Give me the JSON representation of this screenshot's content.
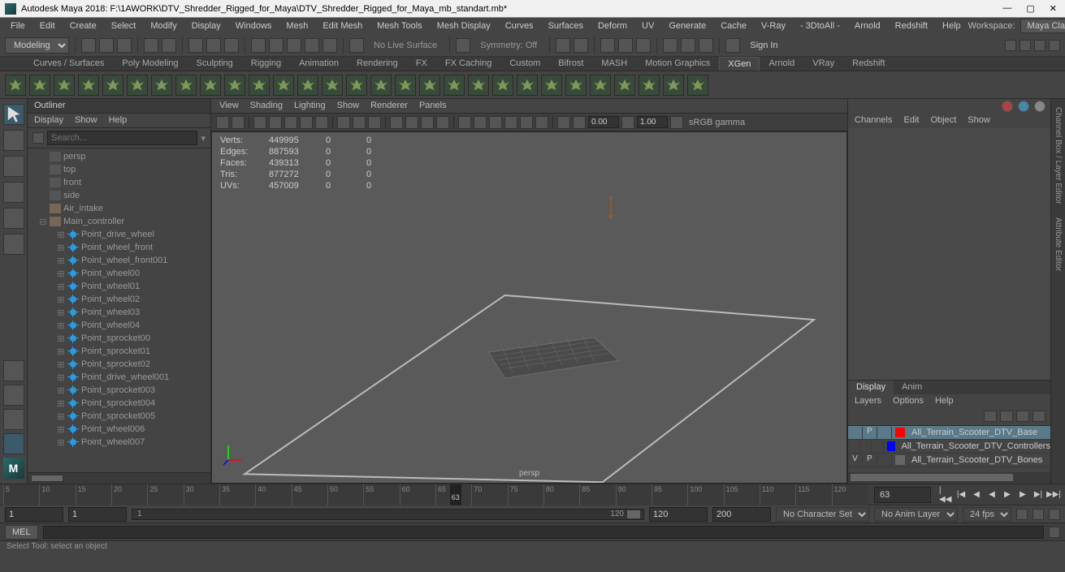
{
  "title": "Autodesk Maya 2018: F:\\1AWORK\\DTV_Shredder_Rigged_for_Maya\\DTV_Shredder_Rigged_for_Maya_mb_standart.mb*",
  "menubar": [
    "File",
    "Edit",
    "Create",
    "Select",
    "Modify",
    "Display",
    "Windows",
    "Mesh",
    "Edit Mesh",
    "Mesh Tools",
    "Mesh Display",
    "Curves",
    "Surfaces",
    "Deform",
    "UV",
    "Generate",
    "Cache",
    "V-Ray",
    "- 3DtoAll -",
    "Arnold",
    "Redshift",
    "Help"
  ],
  "workspace_label": "Workspace:",
  "workspace_value": "Maya Classic*",
  "modeling_menu": "Modeling",
  "no_live_surface": "No Live Surface",
  "symmetry": "Symmetry: Off",
  "sign_in": "Sign In",
  "shelf_tabs": [
    "Curves / Surfaces",
    "Poly Modeling",
    "Sculpting",
    "Rigging",
    "Animation",
    "Rendering",
    "FX",
    "FX Caching",
    "Custom",
    "Bifrost",
    "MASH",
    "Motion Graphics",
    "XGen",
    "Arnold",
    "VRay",
    "Redshift"
  ],
  "shelf_active": "XGen",
  "outliner": {
    "title": "Outliner",
    "menu": [
      "Display",
      "Show",
      "Help"
    ],
    "search_placeholder": "Search...",
    "cameras": [
      "persp",
      "top",
      "front",
      "side"
    ],
    "items": [
      {
        "name": "Air_intake",
        "icon": "grp",
        "indent": 1,
        "exp": ""
      },
      {
        "name": "Main_controller",
        "icon": "grp",
        "indent": 1,
        "exp": "−"
      },
      {
        "name": "Point_drive_wheel",
        "icon": "loc",
        "indent": 2,
        "exp": "+"
      },
      {
        "name": "Point_wheel_front",
        "icon": "loc",
        "indent": 2,
        "exp": "+"
      },
      {
        "name": "Point_wheel_front001",
        "icon": "loc",
        "indent": 2,
        "exp": "+"
      },
      {
        "name": "Point_wheel00",
        "icon": "loc",
        "indent": 2,
        "exp": "+"
      },
      {
        "name": "Point_wheel01",
        "icon": "loc",
        "indent": 2,
        "exp": "+"
      },
      {
        "name": "Point_wheel02",
        "icon": "loc",
        "indent": 2,
        "exp": "+"
      },
      {
        "name": "Point_wheel03",
        "icon": "loc",
        "indent": 2,
        "exp": "+"
      },
      {
        "name": "Point_wheel04",
        "icon": "loc",
        "indent": 2,
        "exp": "+"
      },
      {
        "name": "Point_sprocket00",
        "icon": "loc",
        "indent": 2,
        "exp": "+"
      },
      {
        "name": "Point_sprocket01",
        "icon": "loc",
        "indent": 2,
        "exp": "+"
      },
      {
        "name": "Point_sprocket02",
        "icon": "loc",
        "indent": 2,
        "exp": "+"
      },
      {
        "name": "Point_drive_wheel001",
        "icon": "loc",
        "indent": 2,
        "exp": "+"
      },
      {
        "name": "Point_sprocket003",
        "icon": "loc",
        "indent": 2,
        "exp": "+"
      },
      {
        "name": "Point_sprocket004",
        "icon": "loc",
        "indent": 2,
        "exp": "+"
      },
      {
        "name": "Point_sprocket005",
        "icon": "loc",
        "indent": 2,
        "exp": "+"
      },
      {
        "name": "Point_wheel006",
        "icon": "loc",
        "indent": 2,
        "exp": "+"
      },
      {
        "name": "Point_wheel007",
        "icon": "loc",
        "indent": 2,
        "exp": "+"
      }
    ]
  },
  "viewport": {
    "menu": [
      "View",
      "Shading",
      "Lighting",
      "Show",
      "Renderer",
      "Panels"
    ],
    "num1": "0.00",
    "num2": "1.00",
    "gamma": "sRGB gamma",
    "hud": {
      "rows": [
        {
          "label": "Verts:",
          "v1": "449995",
          "v2": "0",
          "v3": "0"
        },
        {
          "label": "Edges:",
          "v1": "887593",
          "v2": "0",
          "v3": "0"
        },
        {
          "label": "Faces:",
          "v1": "439313",
          "v2": "0",
          "v3": "0"
        },
        {
          "label": "Tris:",
          "v1": "877272",
          "v2": "0",
          "v3": "0"
        },
        {
          "label": "UVs:",
          "v1": "457009",
          "v2": "0",
          "v3": "0"
        }
      ]
    },
    "camera_label": "persp"
  },
  "channelbox": {
    "menu": [
      "Channels",
      "Edit",
      "Object",
      "Show"
    ]
  },
  "layers": {
    "tabs": [
      "Display",
      "Anim"
    ],
    "menu": [
      "Layers",
      "Options",
      "Help"
    ],
    "rows": [
      {
        "v": "",
        "p": "P",
        "c": "#ff0000",
        "name": "All_Terrain_Scooter_DTV_Base",
        "sel": true
      },
      {
        "v": "",
        "p": "",
        "c": "#0000ff",
        "name": "All_Terrain_Scooter_DTV_Controllers",
        "sel": false
      },
      {
        "v": "V",
        "p": "P",
        "c": "#666",
        "name": "All_Terrain_Scooter_DTV_Bones",
        "sel": false
      }
    ]
  },
  "right_tabs": [
    "Channel Box / Layer Editor",
    "Attribute Editor"
  ],
  "time": {
    "ticks": [
      "5",
      "10",
      "15",
      "20",
      "25",
      "30",
      "35",
      "40",
      "45",
      "50",
      "55",
      "60",
      "65",
      "70",
      "75",
      "80",
      "85",
      "90",
      "95",
      "100",
      "105",
      "110",
      "115",
      "120"
    ],
    "current": "63",
    "current_field": "63"
  },
  "range": {
    "start_outer": "1",
    "start_inner": "1",
    "inner_start": "1",
    "inner_end": "120",
    "end_inner": "120",
    "end_outer": "200",
    "char_set": "No Character Set",
    "anim_layer": "No Anim Layer",
    "fps": "24 fps"
  },
  "cmd_lang": "MEL",
  "help_line": "Select Tool: select an object"
}
